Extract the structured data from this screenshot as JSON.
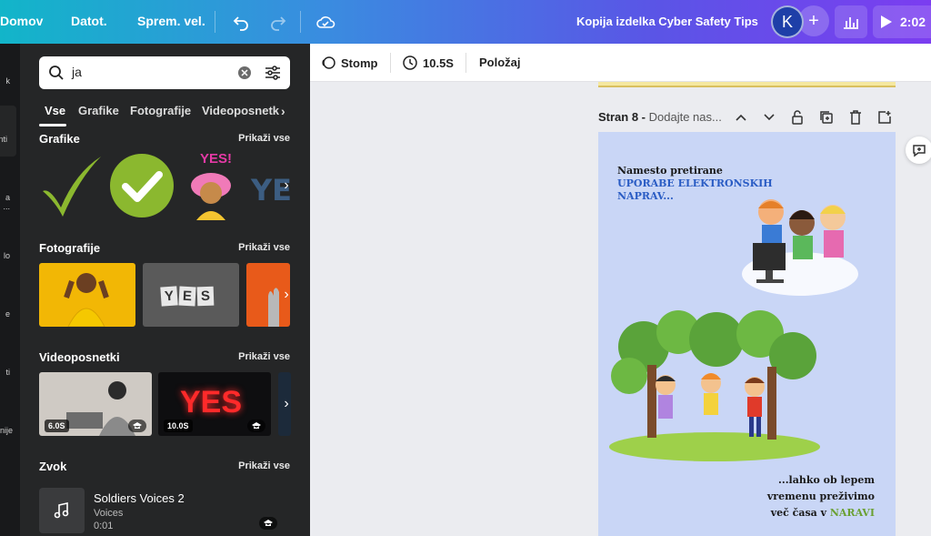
{
  "topbar": {
    "menu": [
      "Domov",
      "Datot.",
      "Sprem. vel."
    ],
    "doc_title": "Kopija izdelka Cyber Safety Tips",
    "avatar_letter": "K",
    "play_label": "2:02",
    "gradient": [
      "#12b5c9",
      "#7b3df0"
    ]
  },
  "rail": {
    "items": [
      "k",
      "nti",
      "a ...",
      "lo",
      "e",
      "ti",
      "nije"
    ]
  },
  "panel": {
    "search": {
      "value": "ja",
      "placeholder": ""
    },
    "tabs": [
      "Vse",
      "Grafike",
      "Fotografije",
      "Videoposnetk"
    ],
    "sections": {
      "graphics": {
        "title": "Grafike",
        "link": "Prikaži vse",
        "yes_text": "YES!"
      },
      "photos": {
        "title": "Fotografije",
        "link": "Prikaži vse",
        "yes_text": "YES"
      },
      "videos": {
        "title": "Videoposnetki",
        "link": "Prikaži vse",
        "items": [
          {
            "dur": "6.0S"
          },
          {
            "dur": "10.0S",
            "text": "YES"
          }
        ]
      },
      "audio": {
        "title": "Zvok",
        "link": "Prikaži vse",
        "item": {
          "title": "Soldiers Voices 2",
          "artist": "Voices",
          "duration": "0:01"
        }
      }
    }
  },
  "toolbar": {
    "animation": "Stomp",
    "duration": "10.5S",
    "position": "Položaj"
  },
  "canvas": {
    "page_number": "Stran 8 -",
    "page_title_placeholder": "Dodajte nas...",
    "page_text": {
      "line1": "Namesto pretirane",
      "line2": "UPORABE ELEKTRONSKIH",
      "line3": "NAPRAV...",
      "line4": "...lahko ob lepem",
      "line5": "vremenu preživimo",
      "line6": "več časa v",
      "line6b": "NARAVI"
    },
    "colors": {
      "page_bg": "#c9d6f6",
      "blue_text": "#2a5cc4",
      "green_text": "#6aa032"
    }
  }
}
